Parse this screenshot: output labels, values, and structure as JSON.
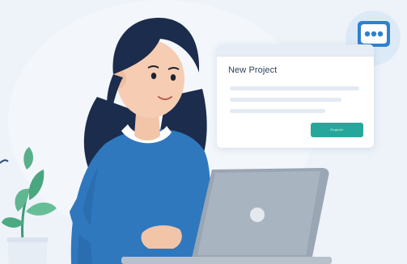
{
  "card": {
    "title": "New Project",
    "button_label": "Register"
  },
  "icons": {
    "chat": "chat-bubble-icon",
    "plant": "plant-icon",
    "laptop": "laptop-icon"
  },
  "colors": {
    "background": "#eef3f9",
    "sweater": "#2f78be",
    "hair": "#1c2c4c",
    "accent_button": "#25a89b",
    "chat_badge": "#dceaf8",
    "chat_bubble": "#2f80d0",
    "laptop": "#9aa6b4",
    "plant_leaf": "#58b08a"
  }
}
